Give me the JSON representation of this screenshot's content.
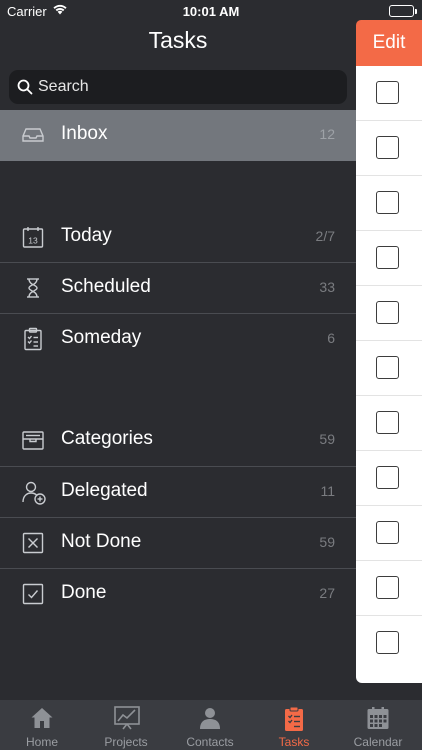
{
  "status_bar": {
    "carrier": "Carrier",
    "time": "10:01 AM"
  },
  "header": {
    "title": "Tasks",
    "edit_label": "Edit"
  },
  "search": {
    "placeholder": "Search"
  },
  "lists": {
    "inbox": {
      "label": "Inbox",
      "count": "12",
      "icon": "inbox-icon"
    },
    "today": {
      "label": "Today",
      "count": "2/7",
      "icon": "calendar-13-icon"
    },
    "scheduled": {
      "label": "Scheduled",
      "count": "33",
      "icon": "hourglass-icon"
    },
    "someday": {
      "label": "Someday",
      "count": "6",
      "icon": "clipboard-list-icon"
    },
    "categories": {
      "label": "Categories",
      "count": "59",
      "icon": "tray-icon"
    },
    "delegated": {
      "label": "Delegated",
      "count": "11",
      "icon": "person-add-icon"
    },
    "not_done": {
      "label": "Not Done",
      "count": "59",
      "icon": "x-box-icon"
    },
    "done": {
      "label": "Done",
      "count": "27",
      "icon": "check-box-icon"
    }
  },
  "task_checkboxes": 11,
  "tabbar": {
    "items": [
      {
        "label": "Home",
        "icon": "home-icon"
      },
      {
        "label": "Projects",
        "icon": "chart-icon"
      },
      {
        "label": "Contacts",
        "icon": "person-icon"
      },
      {
        "label": "Tasks",
        "icon": "clipboard-icon",
        "active": true
      },
      {
        "label": "Calendar",
        "icon": "calendar-icon"
      }
    ]
  },
  "colors": {
    "background": "#2b2c30",
    "selected_row": "#73777d",
    "accent": "#f36a47",
    "tabbar": "#3a3c41"
  }
}
